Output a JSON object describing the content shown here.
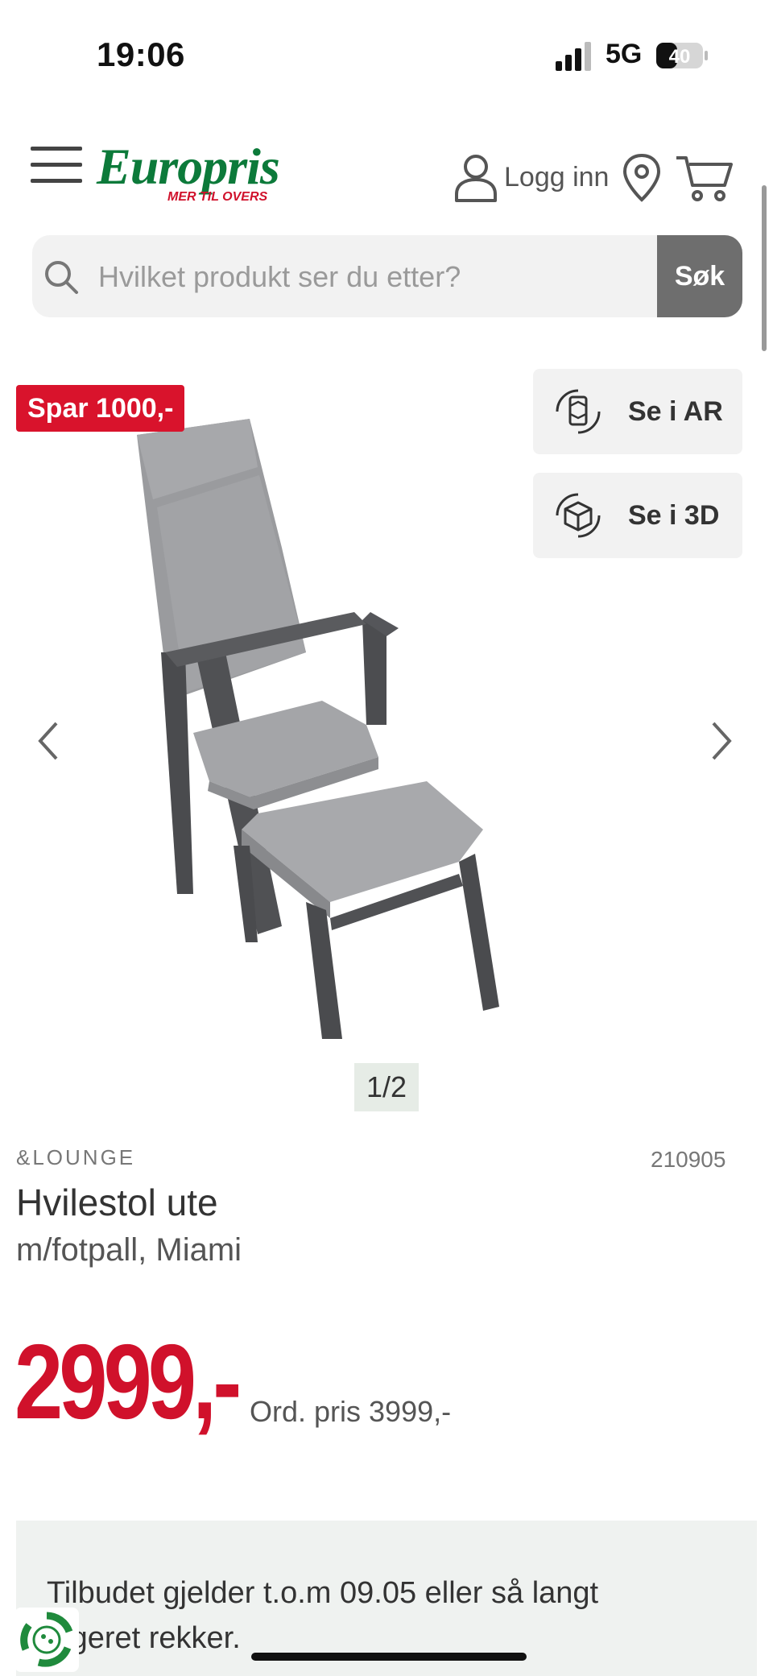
{
  "status": {
    "time": "19:06",
    "network": "5G",
    "battery": "40"
  },
  "header": {
    "logo": {
      "word": "Europris",
      "tagline": "MER TIL OVERS"
    },
    "login_label": "Logg inn"
  },
  "search": {
    "placeholder": "Hvilket produkt ser du etter?",
    "button_label": "Søk"
  },
  "gallery": {
    "badge": "Spar 1000,-",
    "ar_label": "Se i AR",
    "threed_label": "Se i 3D",
    "pager": "1/2"
  },
  "product": {
    "brand": "&LOUNGE",
    "sku": "210905",
    "title": "Hvilestol ute",
    "subtitle": "m/fotpall, Miami",
    "price": "2999,-",
    "ord_price": "Ord. pris 3999,-"
  },
  "offer": {
    "text": "Tilbudet gjelder t.o.m 09.05 eller så langt lageret rekker."
  },
  "colors": {
    "brand_green": "#0c7a3a",
    "sale_red": "#d0112b"
  }
}
